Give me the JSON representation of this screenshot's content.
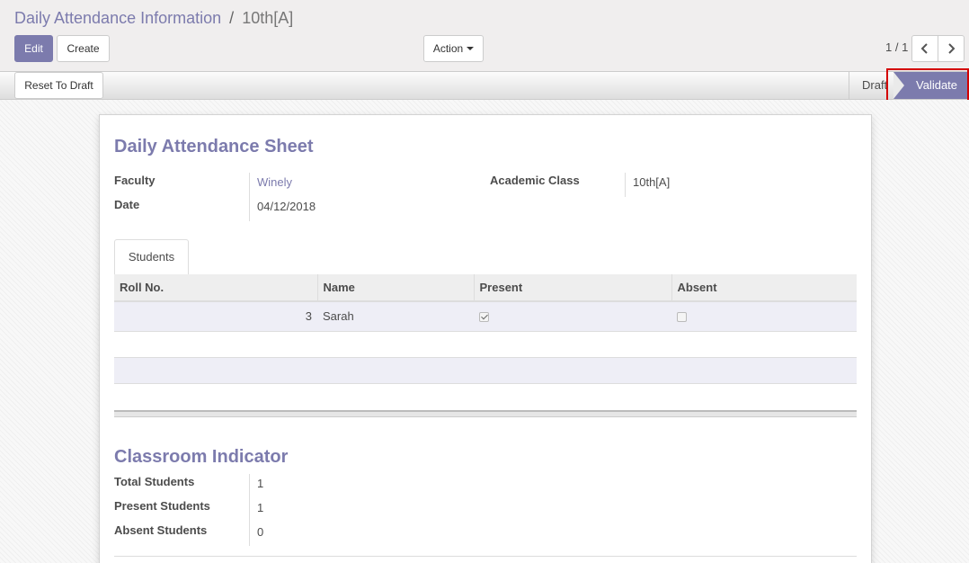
{
  "breadcrumb": {
    "parent": "Daily Attendance Information",
    "separator": "/",
    "current": "10th[A]"
  },
  "toolbar": {
    "edit_label": "Edit",
    "create_label": "Create",
    "action_label": "Action"
  },
  "pager": {
    "value": "1 / 1"
  },
  "statusbar": {
    "reset_label": "Reset To Draft",
    "states": [
      "Draft",
      "Validate"
    ],
    "active_state": "Validate"
  },
  "sheet": {
    "title": "Daily Attendance Sheet",
    "fields": {
      "faculty_label": "Faculty",
      "faculty_value": "Winely",
      "date_label": "Date",
      "date_value": "04/12/2018",
      "class_label": "Academic Class",
      "class_value": "10th[A]"
    },
    "tabs": [
      "Students"
    ],
    "table": {
      "columns": [
        "Roll No.",
        "Name",
        "Present",
        "Absent"
      ],
      "rows": [
        {
          "roll_no": "3",
          "name": "Sarah",
          "present": true,
          "absent": false
        }
      ]
    },
    "indicator": {
      "title": "Classroom Indicator",
      "total_label": "Total Students",
      "total_value": "1",
      "present_label": "Present Students",
      "present_value": "1",
      "absent_label": "Absent Students",
      "absent_value": "0"
    }
  },
  "colors": {
    "accent": "#7c7bad",
    "highlight": "#d40000"
  }
}
